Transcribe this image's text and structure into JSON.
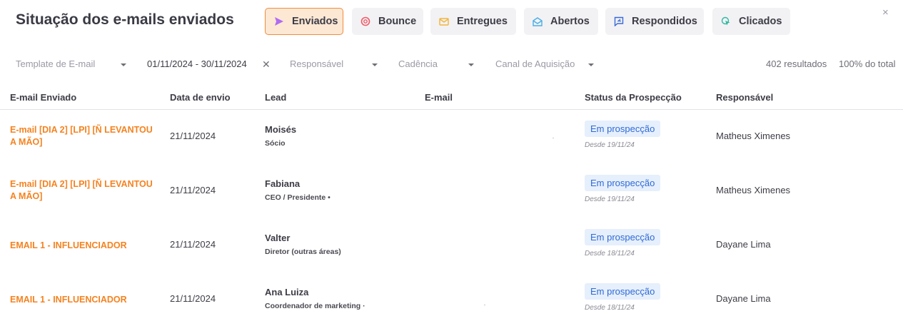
{
  "header": {
    "title": "Situação dos e-mails enviados",
    "tabs": [
      {
        "label": "Enviados",
        "icon": "send-icon",
        "active": true
      },
      {
        "label": "Bounce",
        "icon": "bounce-icon",
        "active": false
      },
      {
        "label": "Entregues",
        "icon": "envelope-icon",
        "active": false
      },
      {
        "label": "Abertos",
        "icon": "envelope-open-icon",
        "active": false
      },
      {
        "label": "Respondidos",
        "icon": "reply-icon",
        "active": false
      },
      {
        "label": "Clicados",
        "icon": "click-icon",
        "active": false
      }
    ],
    "close_label": "×"
  },
  "filters": {
    "template_placeholder": "Template de E-mail",
    "date_range": "01/11/2024 - 30/11/2024",
    "clear_label": "✕",
    "responsavel_placeholder": "Responsável",
    "cadencia_placeholder": "Cadência",
    "canal_placeholder": "Canal de Aquisição",
    "results_count": "402 resultados",
    "results_percent": "100% do total"
  },
  "table": {
    "columns": [
      "E-mail Enviado",
      "Data de envio",
      "Lead",
      "E-mail",
      "Status da Prospecção",
      "Responsável"
    ],
    "rows": [
      {
        "email_sent": "E-mail [DIA 2] [LPI] [Ñ LEVANTOU A MÃO]",
        "date": "21/11/2024",
        "lead_name": "Moisés",
        "lead_role": "Sócio",
        "email": "",
        "status": "Em prospecção",
        "since": "Desde 19/11/24",
        "owner": "Matheus Ximenes"
      },
      {
        "email_sent": "E-mail [DIA 2] [LPI] [Ñ LEVANTOU A MÃO]",
        "date": "21/11/2024",
        "lead_name": "Fabiana",
        "lead_role": "CEO / Presidente •",
        "email": "",
        "status": "Em prospecção",
        "since": "Desde 19/11/24",
        "owner": "Matheus Ximenes"
      },
      {
        "email_sent": "EMAIL 1 - INFLUENCIADOR",
        "date": "21/11/2024",
        "lead_name": "Valter",
        "lead_role": "Diretor (outras áreas)",
        "email": "",
        "status": "Em prospecção",
        "since": "Desde 18/11/24",
        "owner": "Dayane Lima"
      },
      {
        "email_sent": "EMAIL 1 - INFLUENCIADOR",
        "date": "21/11/2024",
        "lead_name": "Ana Luiza",
        "lead_role": "Coordenador de marketing ·",
        "email": "",
        "status": "Em prospecção",
        "since": "Desde 18/11/24",
        "owner": "Dayane Lima"
      }
    ]
  },
  "colors": {
    "accent_orange": "#f5821f",
    "active_tab_bg": "#fde8d4",
    "status_badge_bg": "#e6effc",
    "status_badge_text": "#2f6bd6"
  }
}
